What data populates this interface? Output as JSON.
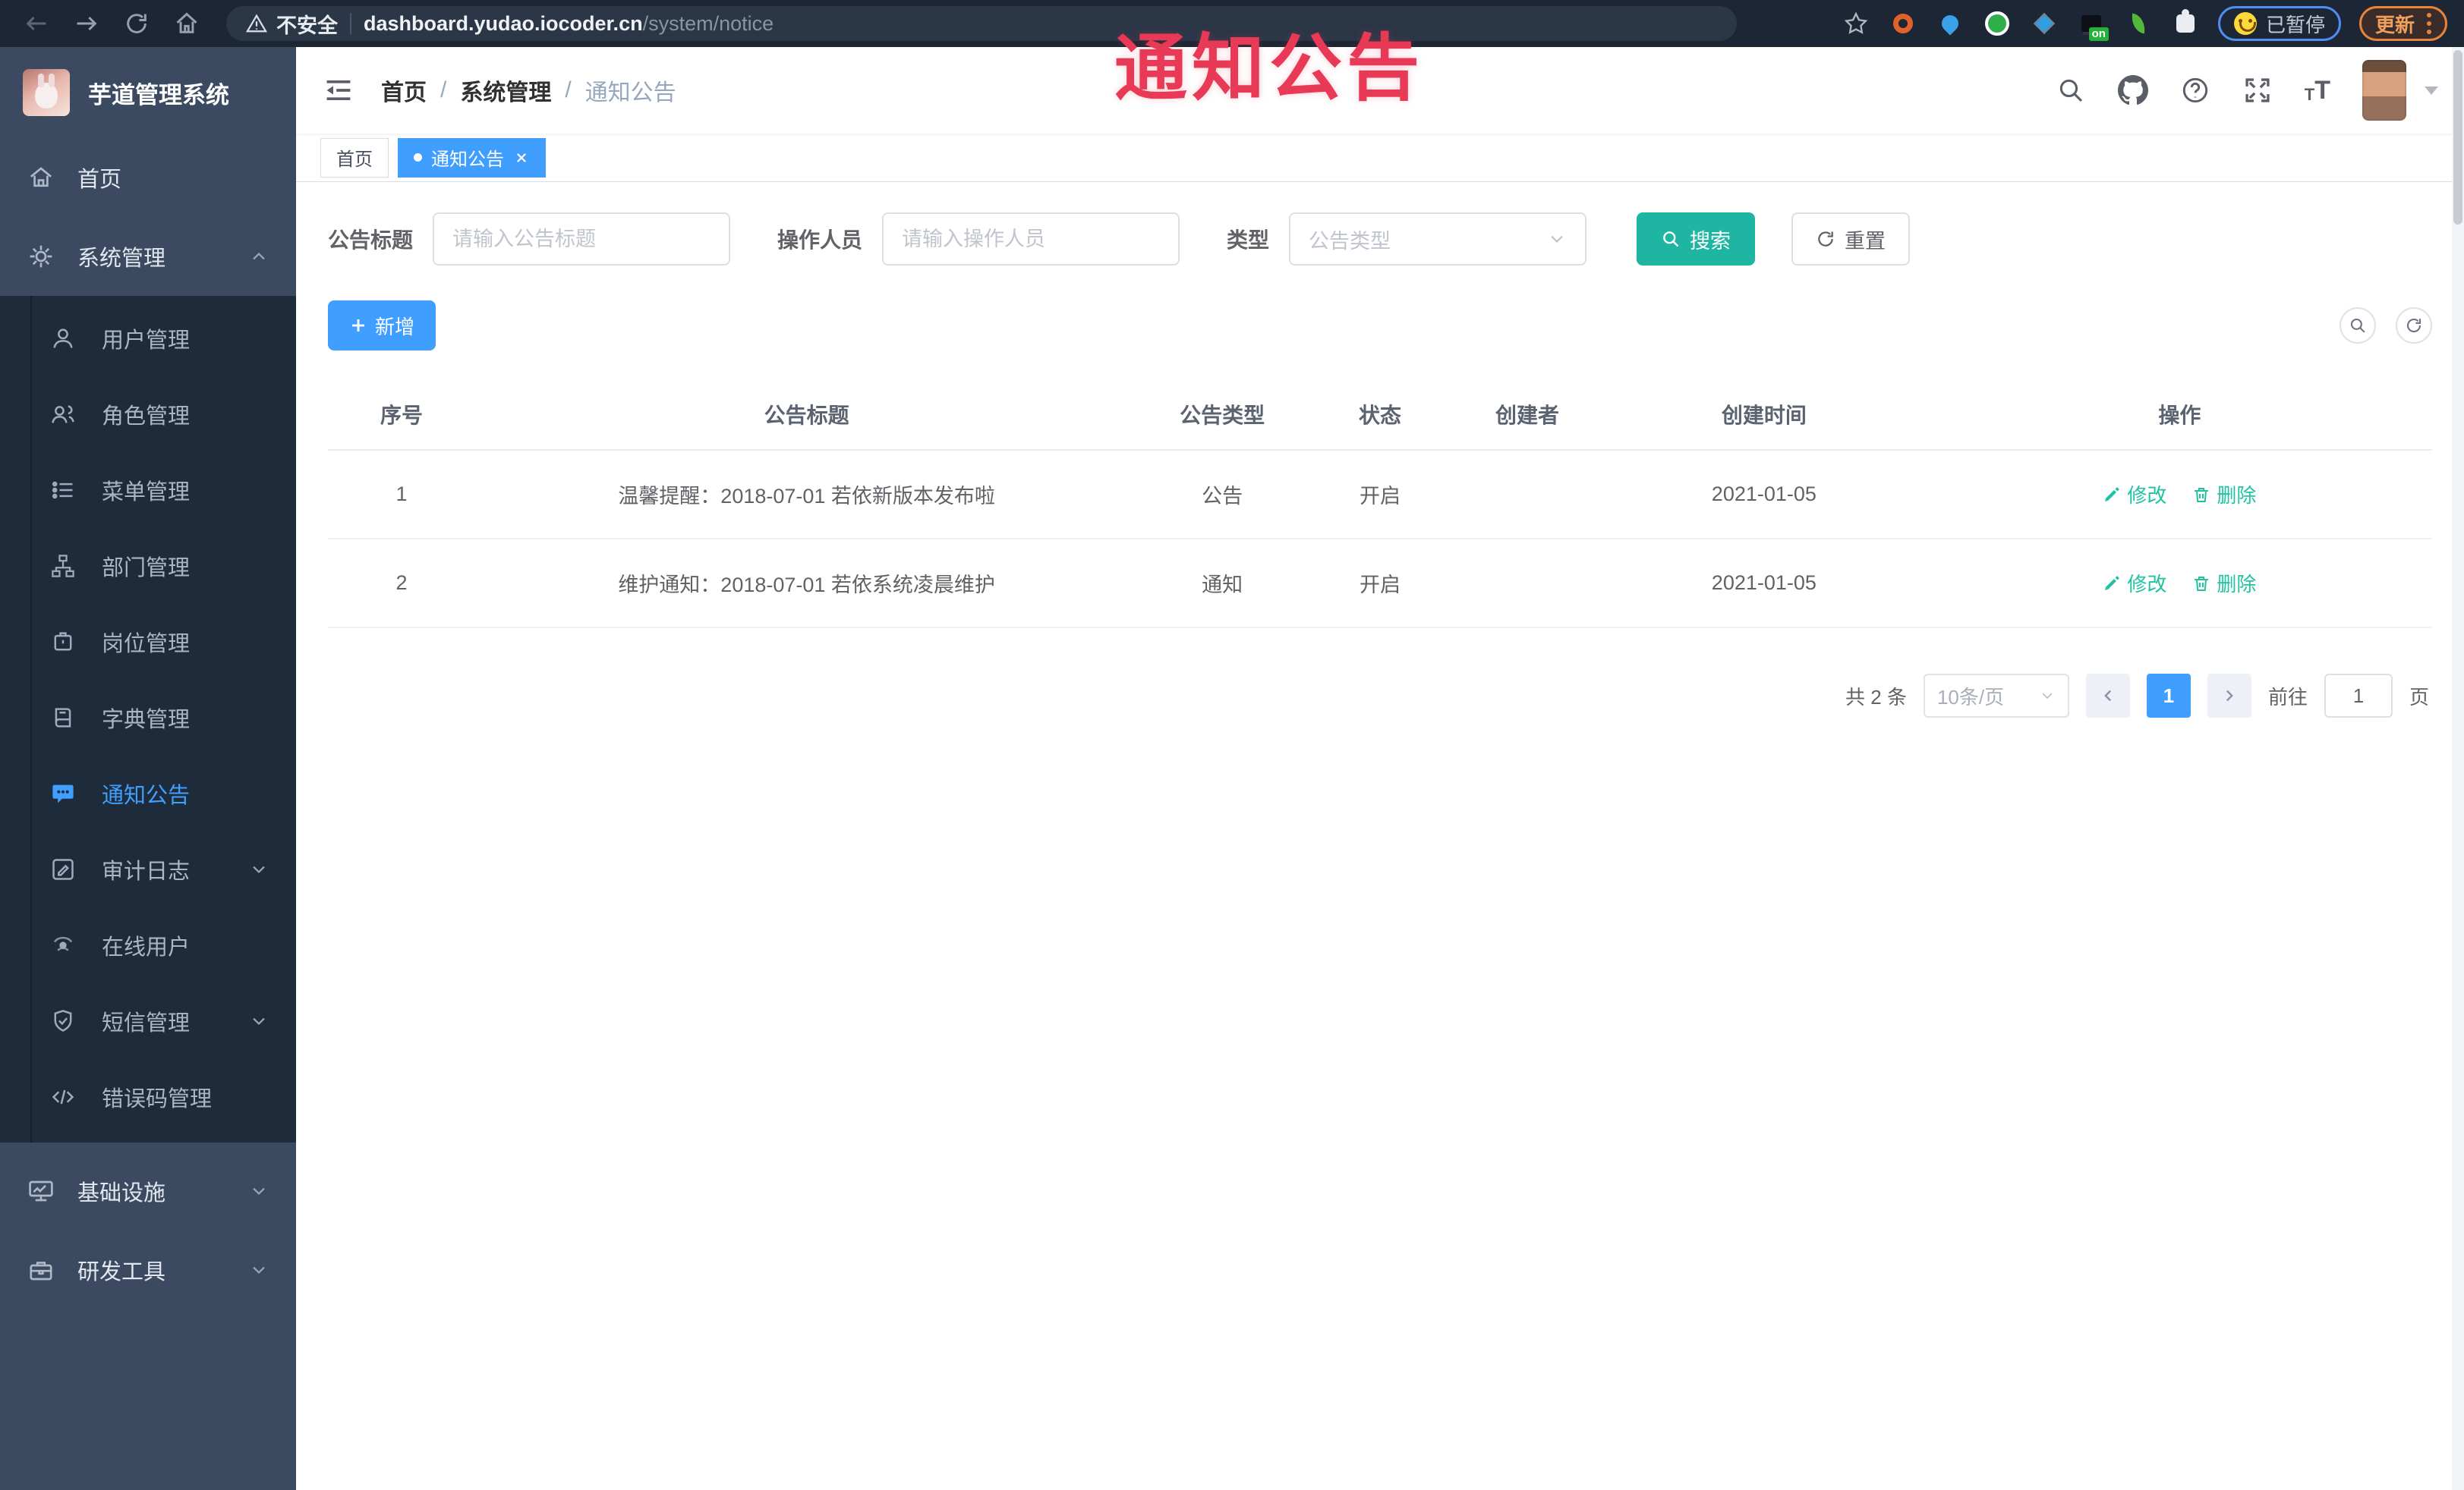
{
  "browser": {
    "security_label": "不安全",
    "url_host": "dashboard.yudao.iocoder.cn",
    "url_path": "/system/notice",
    "extension_on_badge": "on",
    "paused_badge": "已暂停",
    "update_button": "更新"
  },
  "annotation": {
    "text": "通知公告",
    "color": "#e83a56"
  },
  "sidebar": {
    "title": "芋道管理系统",
    "items": [
      {
        "label": "首页"
      },
      {
        "label": "系统管理"
      },
      {
        "label": "基础设施"
      },
      {
        "label": "研发工具"
      }
    ],
    "system_children": [
      {
        "label": "用户管理"
      },
      {
        "label": "角色管理"
      },
      {
        "label": "菜单管理"
      },
      {
        "label": "部门管理"
      },
      {
        "label": "岗位管理"
      },
      {
        "label": "字典管理"
      },
      {
        "label": "通知公告",
        "active": true
      },
      {
        "label": "审计日志"
      },
      {
        "label": "在线用户"
      },
      {
        "label": "短信管理"
      },
      {
        "label": "错误码管理"
      }
    ]
  },
  "navbar": {
    "breadcrumb": [
      "首页",
      "系统管理",
      "通知公告"
    ],
    "separator": "/"
  },
  "tabs": [
    {
      "label": "首页",
      "active": false
    },
    {
      "label": "通知公告",
      "active": true
    }
  ],
  "filters": {
    "title": {
      "label": "公告标题",
      "placeholder": "请输入公告标题"
    },
    "operator": {
      "label": "操作人员",
      "placeholder": "请输入操作人员"
    },
    "type": {
      "label": "类型",
      "placeholder": "公告类型"
    },
    "search_label": "搜索",
    "reset_label": "重置"
  },
  "toolbar": {
    "add_label": "新增"
  },
  "table": {
    "headers": [
      "序号",
      "公告标题",
      "公告类型",
      "状态",
      "创建者",
      "创建时间",
      "操作"
    ],
    "rows": [
      {
        "no": "1",
        "title": "温馨提醒：2018-07-01 若依新版本发布啦",
        "type": "公告",
        "status": "开启",
        "creator": "",
        "created": "2021-01-05"
      },
      {
        "no": "2",
        "title": "维护通知：2018-07-01 若依系统凌晨维护",
        "type": "通知",
        "status": "开启",
        "creator": "",
        "created": "2021-01-05"
      }
    ],
    "edit_label": "修改",
    "delete_label": "删除"
  },
  "pagination": {
    "total": "共 2 条",
    "page_size": "10条/页",
    "current_page": "1",
    "goto_label": "前往",
    "goto_value": "1",
    "page_unit": "页"
  },
  "theme": {
    "primary": "#409EFF",
    "accent": "#1FB5A3"
  }
}
